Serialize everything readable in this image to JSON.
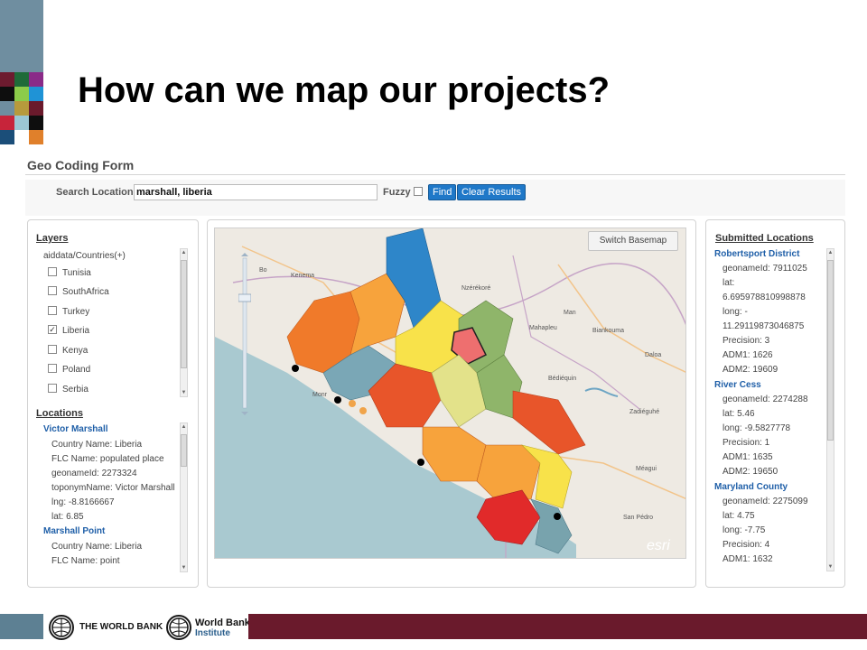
{
  "slide": {
    "title": "How can we map our projects?"
  },
  "form": {
    "title": "Geo Coding Form",
    "search_label": "Search Location",
    "search_value": "marshall, liberia",
    "fuzzy_label": "Fuzzy",
    "find_label": "Find",
    "clear_label": "Clear Results"
  },
  "layers": {
    "header": "Layers",
    "group_label": "aiddata/Countries(+)",
    "items": [
      {
        "label": "Tunisia",
        "checked": false
      },
      {
        "label": "SouthAfrica",
        "checked": false
      },
      {
        "label": "Turkey",
        "checked": false
      },
      {
        "label": "Liberia",
        "checked": true
      },
      {
        "label": "Kenya",
        "checked": false
      },
      {
        "label": "Poland",
        "checked": false
      },
      {
        "label": "Serbia",
        "checked": false
      }
    ]
  },
  "locations": {
    "header": "Locations",
    "entries": [
      {
        "title": "Victor Marshall",
        "lines": [
          "Country Name: Liberia",
          "FLC Name: populated place",
          "geonameId: 2273324",
          "toponymName: Victor Marshall",
          "lng: -8.8166667",
          "lat: 6.85"
        ]
      },
      {
        "title": "Marshall Point",
        "lines": [
          "Country Name: Liberia",
          "FLC Name: point"
        ]
      }
    ]
  },
  "map": {
    "basemap_button": "Switch Basemap",
    "attribution": "esri",
    "places": [
      "Bo",
      "Kenema",
      "Monr",
      "Nzérékoré",
      "Man",
      "Mahapleu",
      "Biankouma",
      "Daloa",
      "Bédiéquin",
      "Zadiéguhé",
      "Méagui",
      "San Pédro"
    ]
  },
  "submitted": {
    "header": "Submitted Locations",
    "entries": [
      {
        "title": "Robertsport District",
        "lines": [
          "geonameId: 7911025",
          "lat:",
          "6.695978810998878",
          "long: -",
          "11.29119873046875",
          "Precision: 3",
          "ADM1: 1626",
          "ADM2: 19609"
        ]
      },
      {
        "title": "River Cess",
        "lines": [
          "geonameId: 2274288",
          "lat: 5.46",
          "long: -9.5827778",
          "Precision: 1",
          "ADM1: 1635",
          "ADM2: 19650"
        ]
      },
      {
        "title": "Maryland County",
        "lines": [
          "geonameId: 2275099",
          "lat: 4.75",
          "long: -7.75",
          "Precision: 4",
          "ADM1: 1632"
        ]
      }
    ]
  },
  "footer": {
    "wb_name": "THE WORLD BANK",
    "wbi_line1": "World Bank",
    "wbi_line2": "Institute"
  },
  "colors": {
    "accent_blue": "#1f78c8",
    "footer_maroon": "#6a1a2c",
    "ocean": "#a9c9d0"
  }
}
